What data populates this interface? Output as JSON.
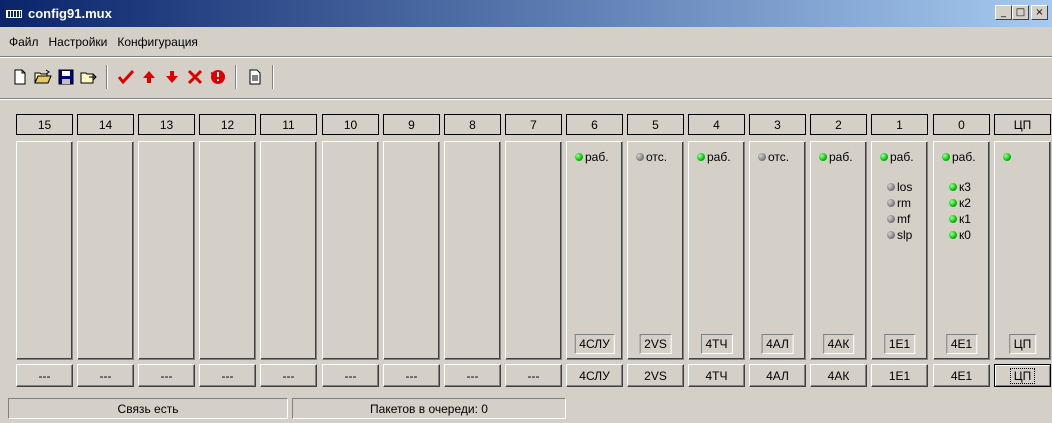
{
  "window": {
    "title": "config91.mux",
    "minimize": "_",
    "maximize": "□",
    "close": "×"
  },
  "menu": [
    "Файл",
    "Настройки",
    "Конфигурация"
  ],
  "toolbar": {
    "icons": [
      "new-file-icon",
      "open-folder-icon",
      "save-icon",
      "export-icon",
      "check-icon",
      "arrow-up-icon",
      "arrow-down-icon",
      "delete-icon",
      "reset-icon",
      "report-icon"
    ],
    "colors": {
      "red": "#e00000",
      "blue": "#000080"
    }
  },
  "slots": [
    {
      "header": "15",
      "button": "---"
    },
    {
      "header": "14",
      "button": "---"
    },
    {
      "header": "13",
      "button": "---"
    },
    {
      "header": "12",
      "button": "---"
    },
    {
      "header": "11",
      "button": "---"
    },
    {
      "header": "10",
      "button": "---"
    },
    {
      "header": "9",
      "button": "---"
    },
    {
      "header": "8",
      "button": "---"
    },
    {
      "header": "7",
      "button": "---"
    },
    {
      "header": "6",
      "button": "4СЛУ",
      "module": "4СЛУ",
      "status": {
        "color": "green",
        "text": "раб."
      }
    },
    {
      "header": "5",
      "button": "2VS",
      "module": "2VS",
      "status": {
        "color": "gray",
        "text": "отс."
      }
    },
    {
      "header": "4",
      "button": "4ТЧ",
      "module": "4ТЧ",
      "status": {
        "color": "green",
        "text": "раб."
      }
    },
    {
      "header": "3",
      "button": "4АЛ",
      "module": "4АЛ",
      "status": {
        "color": "gray",
        "text": "отс."
      }
    },
    {
      "header": "2",
      "button": "4АК",
      "module": "4АК",
      "status": {
        "color": "green",
        "text": "раб."
      }
    },
    {
      "header": "1",
      "button": "1Е1",
      "module": "1Е1",
      "status": {
        "color": "green",
        "text": "раб."
      },
      "sub": [
        {
          "color": "gray",
          "text": "los"
        },
        {
          "color": "gray",
          "text": "rm"
        },
        {
          "color": "gray",
          "text": "mf"
        },
        {
          "color": "gray",
          "text": "slp"
        }
      ]
    },
    {
      "header": "0",
      "button": "4Е1",
      "module": "4Е1",
      "status": {
        "color": "green",
        "text": "раб."
      },
      "sub": [
        {
          "color": "green",
          "text": "к3"
        },
        {
          "color": "green",
          "text": "к2"
        },
        {
          "color": "green",
          "text": "к1"
        },
        {
          "color": "green",
          "text": "к0"
        }
      ]
    },
    {
      "header": "ЦП",
      "button": "ЦП",
      "module": "ЦП",
      "focused": true,
      "status": {
        "color": "green",
        "text": ""
      }
    }
  ],
  "statusbar": {
    "connection": "Связь есть",
    "queue": "Пакетов в очереди: 0"
  }
}
